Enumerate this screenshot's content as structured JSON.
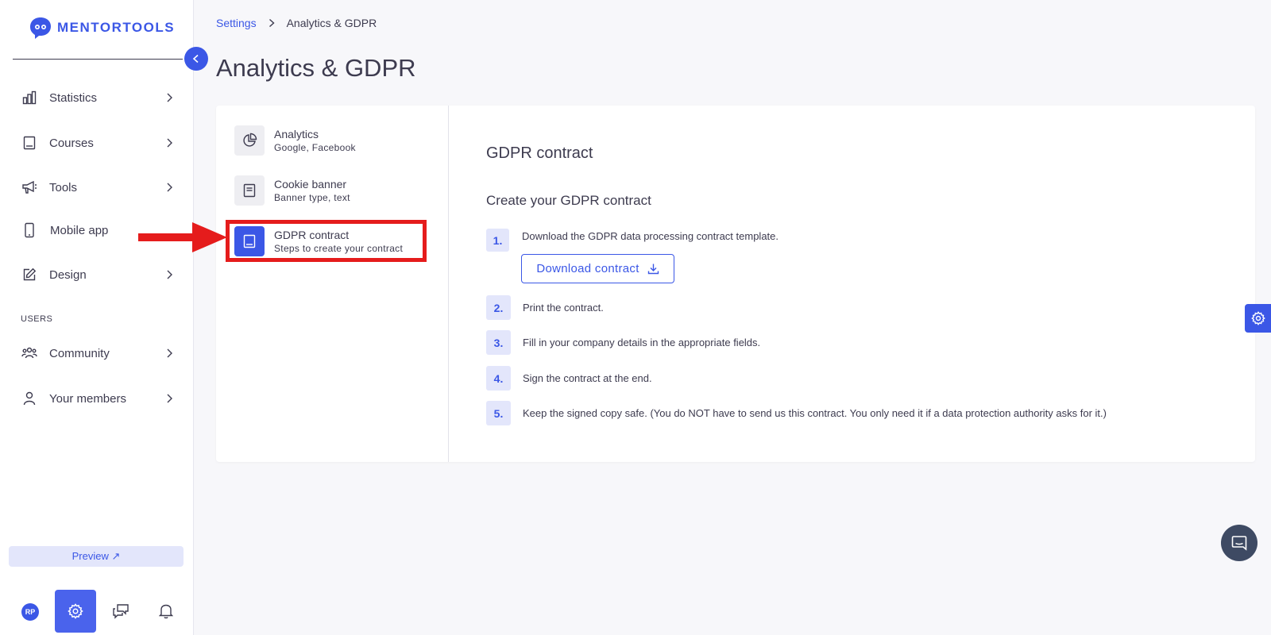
{
  "brand": {
    "name": "MENTORTOOLS",
    "color": "#3b57e6"
  },
  "sidebar": {
    "items": [
      {
        "label": "Statistics",
        "icon": "bar-chart-icon",
        "has_chevron": true
      },
      {
        "label": "Courses",
        "icon": "book-icon",
        "has_chevron": true
      },
      {
        "label": "Tools",
        "icon": "megaphone-icon",
        "has_chevron": true
      },
      {
        "label": "Mobile app",
        "icon": "mobile-icon",
        "has_chevron": false
      },
      {
        "label": "Design",
        "icon": "pencil-edit-icon",
        "has_chevron": true
      }
    ],
    "users_section_label": "USERS",
    "user_items": [
      {
        "label": "Community",
        "icon": "community-icon",
        "has_chevron": true
      },
      {
        "label": "Your members",
        "icon": "user-icon",
        "has_chevron": true
      }
    ],
    "preview_label": "Preview ↗",
    "avatar_initials": "RP"
  },
  "breadcrumb": {
    "parent": "Settings",
    "current": "Analytics & GDPR"
  },
  "page_title": "Analytics & GDPR",
  "settings_menu": [
    {
      "title": "Analytics",
      "subtitle": "Google, Facebook",
      "icon": "pie-chart-icon",
      "active": false
    },
    {
      "title": "Cookie banner",
      "subtitle": "Banner type, text",
      "icon": "document-icon",
      "active": false
    },
    {
      "title": "GDPR contract",
      "subtitle": "Steps to create your contract",
      "icon": "book-icon",
      "active": true
    }
  ],
  "gdpr": {
    "title": "GDPR contract",
    "subtitle": "Create your GDPR contract",
    "download_label": "Download contract",
    "steps": [
      {
        "num": "1.",
        "text": "Download the GDPR data processing contract template."
      },
      {
        "num": "2.",
        "text": "Print the contract."
      },
      {
        "num": "3.",
        "text": "Fill in your company details in the appropriate fields."
      },
      {
        "num": "4.",
        "text": "Sign the contract at the end."
      },
      {
        "num": "5.",
        "text": "Keep the signed copy safe. (You do NOT have to send us this contract. You only need it if a data protection authority asks for it.)"
      }
    ]
  },
  "annotation": {
    "color": "#e51c1c"
  }
}
